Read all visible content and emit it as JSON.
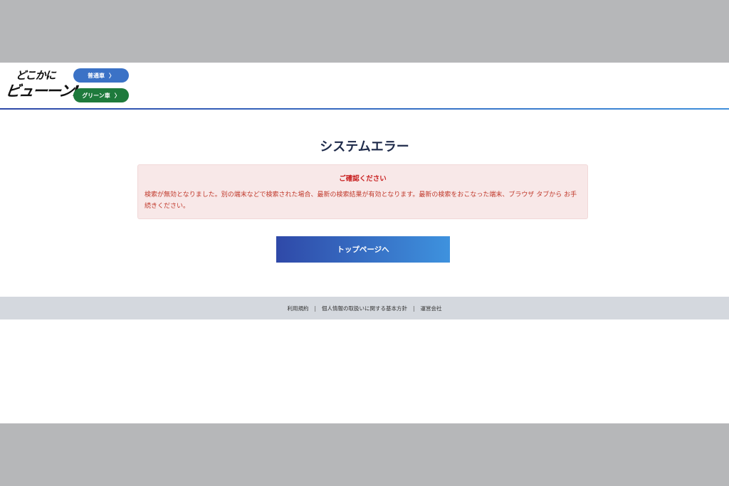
{
  "header": {
    "logo_line1": "どこかに",
    "logo_line2": "ビューーン!",
    "btn_regular": "普通車",
    "btn_green": "グリーン車",
    "chevron": "〉"
  },
  "main": {
    "title": "システムエラー",
    "alert_title": "ご確認ください",
    "alert_message": "検索が無効となりました。別の端末などで検索された場合、最新の検索結果が有効となります。最新の検索をおこなった端末、ブラウザ タブから お手続きください。",
    "cta_label": "トップページへ"
  },
  "footer": {
    "links": [
      "利用規約",
      "個人情報の取扱いに関する基本方針",
      "運営会社"
    ],
    "separator": "|"
  },
  "colors": {
    "primary_blue": "#2f49a8",
    "accent_blue": "#3e92de",
    "green": "#1e7a3c",
    "alert_bg": "#f8e8e8",
    "alert_text": "#c81e1e"
  }
}
